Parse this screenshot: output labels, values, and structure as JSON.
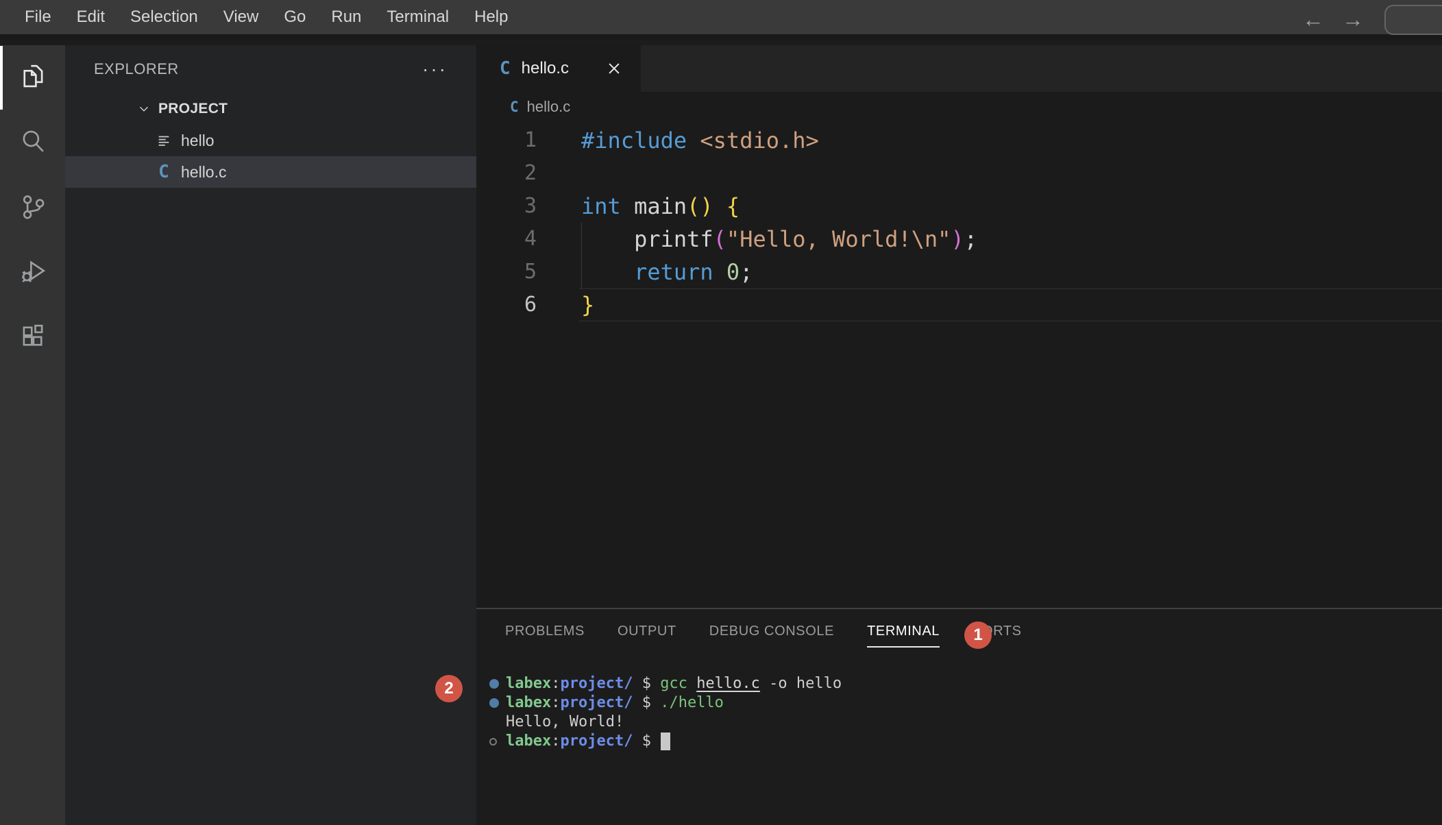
{
  "menu_bar": {
    "items": [
      "File",
      "Edit",
      "Selection",
      "View",
      "Go",
      "Run",
      "Terminal",
      "Help"
    ]
  },
  "title_nav": {
    "back": "←",
    "forward": "→"
  },
  "activity_bar": {
    "items": [
      {
        "name": "explorer",
        "active": true
      },
      {
        "name": "search",
        "active": false
      },
      {
        "name": "source-control",
        "active": false
      },
      {
        "name": "run-debug",
        "active": false
      },
      {
        "name": "extensions",
        "active": false
      }
    ]
  },
  "explorer": {
    "title": "EXPLORER",
    "more_actions": "···",
    "section": "PROJECT",
    "files": [
      {
        "name": "hello",
        "icon": "file-lines",
        "selected": false
      },
      {
        "name": "hello.c",
        "icon": "c-language",
        "selected": true
      }
    ]
  },
  "editor": {
    "tab": {
      "icon": "C",
      "label": "hello.c"
    },
    "breadcrumb": {
      "icon": "C",
      "label": "hello.c"
    },
    "code_lines": [
      {
        "num": "1",
        "tokens": [
          [
            "kw",
            "#include"
          ],
          [
            "pl",
            " "
          ],
          [
            "str",
            "<stdio.h>"
          ]
        ]
      },
      {
        "num": "2",
        "tokens": []
      },
      {
        "num": "3",
        "tokens": [
          [
            "kw",
            "int"
          ],
          [
            "pl",
            " main"
          ],
          [
            "b1",
            "()"
          ],
          [
            "pl",
            " "
          ],
          [
            "b1",
            "{"
          ]
        ]
      },
      {
        "num": "4",
        "tokens": [
          [
            "pl",
            "    printf"
          ],
          [
            "b2",
            "("
          ],
          [
            "str",
            "\"Hello, World!\\n\""
          ],
          [
            "b2",
            ")"
          ],
          [
            "pl",
            ";"
          ]
        ]
      },
      {
        "num": "5",
        "tokens": [
          [
            "pl",
            "    "
          ],
          [
            "kw",
            "return"
          ],
          [
            "pl",
            " "
          ],
          [
            "num",
            "0"
          ],
          [
            "pl",
            ";"
          ]
        ]
      },
      {
        "num": "6",
        "tokens": [
          [
            "b1",
            "}"
          ]
        ],
        "active": true
      }
    ]
  },
  "panel": {
    "tabs": [
      {
        "label": "PROBLEMS",
        "active": false
      },
      {
        "label": "OUTPUT",
        "active": false
      },
      {
        "label": "DEBUG CONSOLE",
        "active": false
      },
      {
        "label": "TERMINAL",
        "active": true
      },
      {
        "label": "PORTS",
        "active": false
      }
    ],
    "terminal": {
      "lines": [
        {
          "deco": "filled",
          "cursor": false,
          "tokens": [
            [
              "user",
              "labex"
            ],
            [
              "pl",
              ":"
            ],
            [
              "path",
              "project/"
            ],
            [
              "pl",
              " $ "
            ],
            [
              "cmd",
              "gcc "
            ],
            [
              "link",
              "hello.c"
            ],
            [
              "pl",
              " -o hello"
            ]
          ]
        },
        {
          "deco": "filled",
          "cursor": false,
          "tokens": [
            [
              "user",
              "labex"
            ],
            [
              "pl",
              ":"
            ],
            [
              "path",
              "project/"
            ],
            [
              "pl",
              " $ "
            ],
            [
              "cmd",
              "./hello"
            ]
          ]
        },
        {
          "deco": "none",
          "cursor": false,
          "tokens": [
            [
              "pl",
              "Hello, World!"
            ]
          ]
        },
        {
          "deco": "open",
          "cursor": true,
          "tokens": [
            [
              "user",
              "labex"
            ],
            [
              "pl",
              ":"
            ],
            [
              "path",
              "project/"
            ],
            [
              "pl",
              " $ "
            ]
          ]
        }
      ]
    }
  },
  "annotations": {
    "badges": [
      {
        "label": "1"
      },
      {
        "label": "2"
      }
    ]
  },
  "colors": {
    "badge_red": "#d15547",
    "c_icon_blue": "#5b94bb",
    "terminal_green": "#82c98f",
    "terminal_blue": "#6d8ce8",
    "keyword_blue": "#569cd6",
    "string_tan": "#cfa080"
  }
}
